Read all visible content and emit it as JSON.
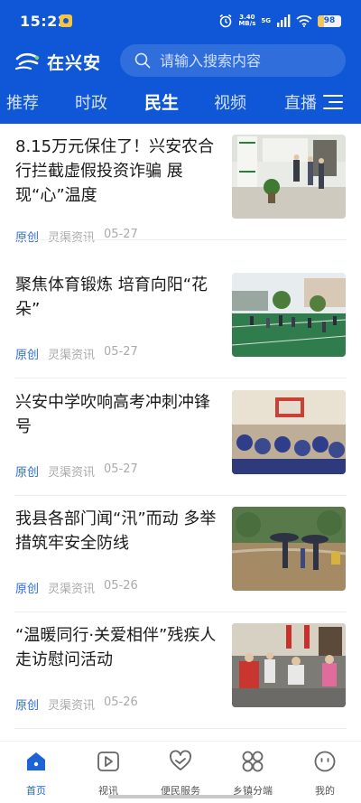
{
  "status_bar": {
    "time": "15:22",
    "net_speed": "3.40",
    "net_unit": "MB/s",
    "network_type": "5G",
    "battery": "98",
    "icons": [
      "app-notification-icon",
      "alarm-icon",
      "signal-bars-icon",
      "wifi-icon",
      "battery-icon"
    ]
  },
  "header": {
    "brand": "在兴安",
    "search_placeholder": "请输入搜索内容",
    "tabs": [
      {
        "label": "推荐"
      },
      {
        "label": "时政"
      },
      {
        "label": "民生",
        "active": true
      },
      {
        "label": "视频"
      },
      {
        "label": "直播"
      }
    ],
    "menu_icon": "menu-icon"
  },
  "news": [
    {
      "title": "8.15万元保住了！兴安农合行拦截虚假投资诈骗 展现“心”温度",
      "tag": "原创",
      "source": "灵渠资讯",
      "date": "05-27"
    },
    {
      "title": "聚焦体育锻炼 培育向阳“花朵”",
      "tag": "原创",
      "source": "灵渠资讯",
      "date": "05-27"
    },
    {
      "title": "兴安中学吹响高考冲刺冲锋号",
      "tag": "原创",
      "source": "灵渠资讯",
      "date": "05-27"
    },
    {
      "title": "我县各部门闻“汛”而动 多举措筑牢安全防线",
      "tag": "原创",
      "source": "灵渠资讯",
      "date": "05-26"
    },
    {
      "title": "“温暖同行·关爱相伴”残疾人走访慰问活动",
      "tag": "原创",
      "source": "灵渠资讯",
      "date": "05-26"
    }
  ],
  "bottom_nav": [
    {
      "label": "首页",
      "icon": "home-icon",
      "active": true
    },
    {
      "label": "视讯",
      "icon": "video-play-icon"
    },
    {
      "label": "便民服务",
      "icon": "heart-hand-icon"
    },
    {
      "label": "乡镇分端",
      "icon": "grid-flower-icon"
    },
    {
      "label": "我的",
      "icon": "smile-face-icon"
    }
  ],
  "colors": {
    "header_bg": "#0f57d6",
    "accent": "#1e63d6",
    "tag": "#2f6ed8",
    "meta": "#aaaaaa"
  }
}
